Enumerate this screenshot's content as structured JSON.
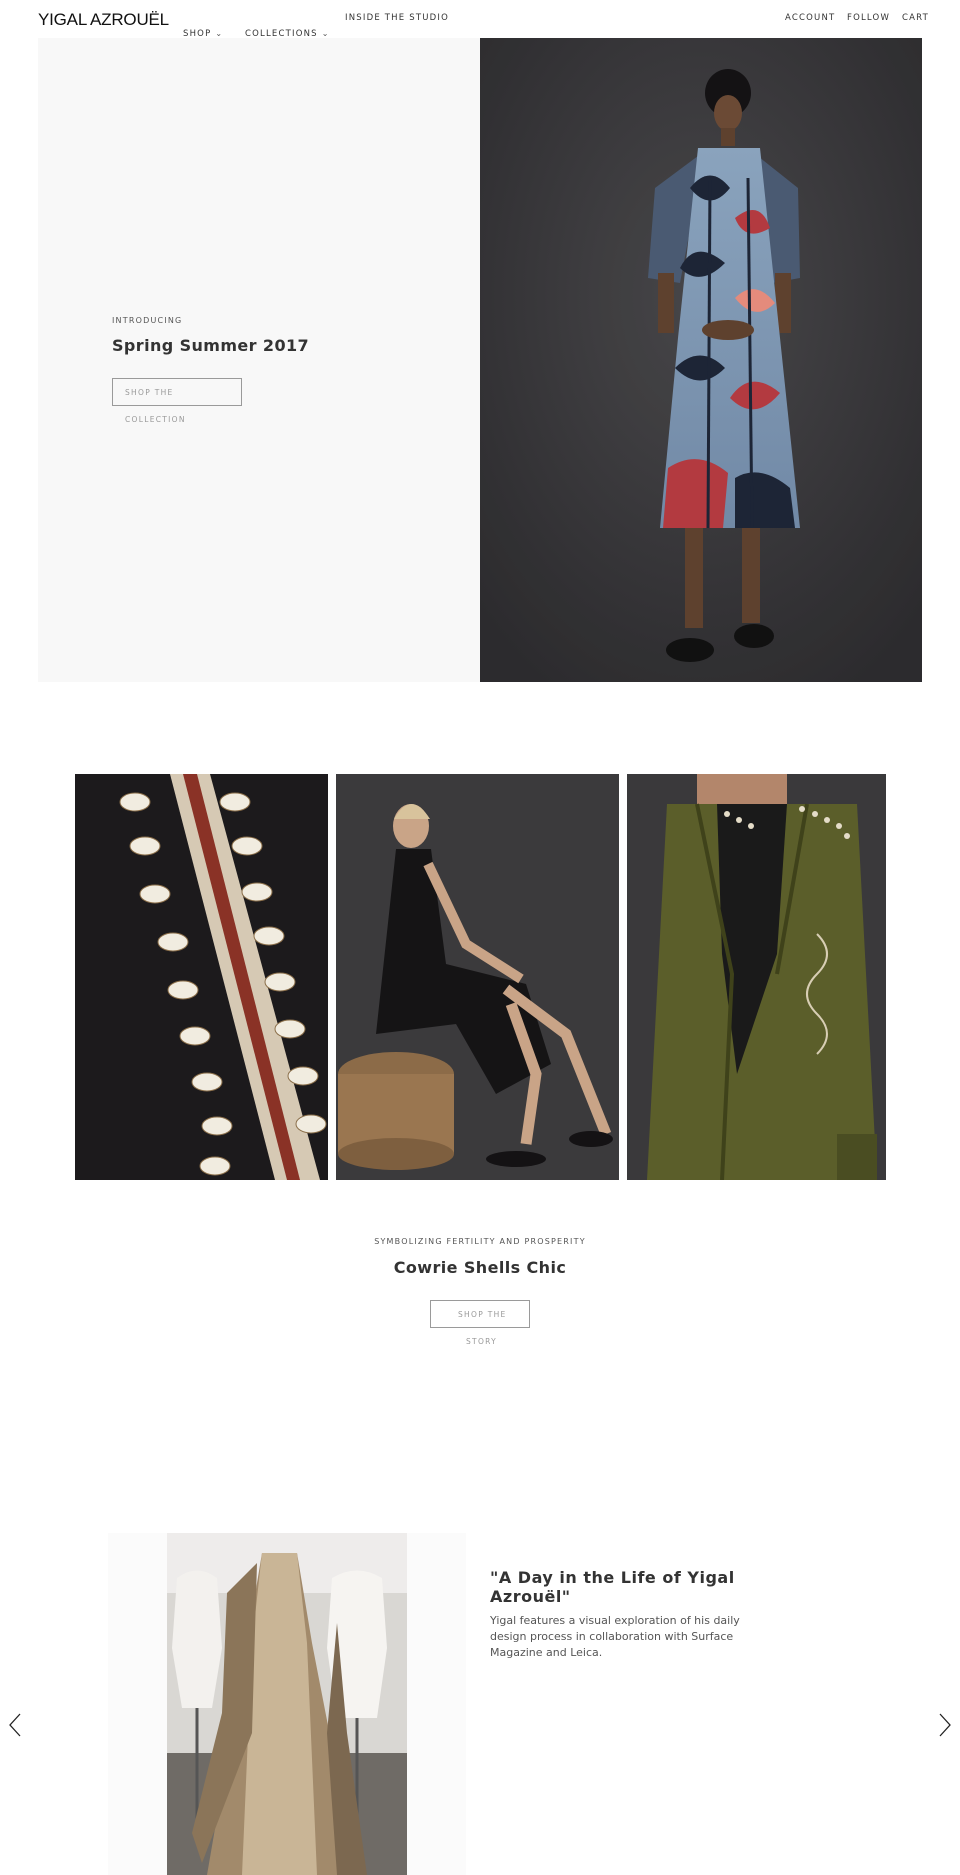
{
  "header": {
    "logo": "YIGAL AZROUËL",
    "nav": {
      "shop": "SHOP",
      "collections": "COLLECTIONS",
      "inside_studio": "INSIDE THE STUDIO",
      "account": "ACCOUNT",
      "follow": "FOLLOW",
      "cart": "CART"
    },
    "icons": {
      "dropdown": "chevron-down-icon"
    }
  },
  "hero": {
    "eyebrow": "INTRODUCING",
    "title": "Spring Summer 2017",
    "button_line1": "SHOP THE",
    "button_line2": "COLLECTION",
    "image": "model-in-printed-dress-photo"
  },
  "feature": {
    "eyebrow": "SYMBOLIZING FERTILITY AND PROSPERITY",
    "title": "Cowrie Shells Chic",
    "button_line1": "SHOP THE",
    "button_line2": "STORY",
    "images": [
      "cowrie-embroidery-detail-photo",
      "model-seated-black-dress-photo",
      "olive-leather-jacket-photo"
    ]
  },
  "studio": {
    "title": "\"A Day in the Life of Yigal Azrouël\"",
    "body": "Yigal features a visual exploration of his daily design process in collaboration with Surface Magazine and Leica.",
    "image": "dress-forms-atelier-photo",
    "prev_icon": "chevron-left-icon",
    "next_icon": "chevron-right-icon"
  },
  "colors": {
    "hero_panel": "#f8f8f8",
    "studio_backdrop": "#3e3d3f",
    "tile_dark": "#1c1a1c",
    "jacket_olive": "#5b5e2a"
  }
}
